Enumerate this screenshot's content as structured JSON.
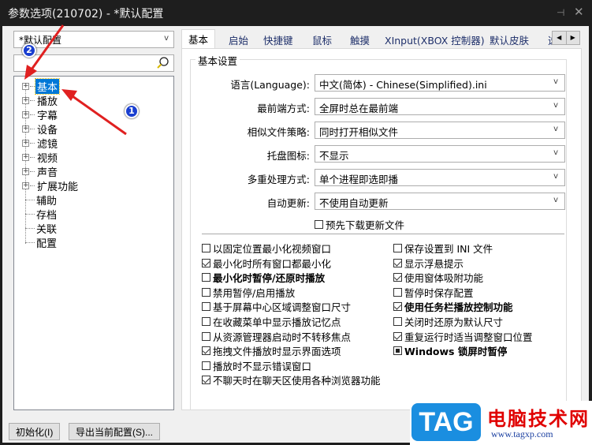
{
  "window": {
    "title": "参数选项(210702) - *默认配置",
    "pin_icon": "pin-icon",
    "close_icon": "close-icon"
  },
  "sidebar": {
    "profile_select": "*默认配置",
    "search_placeholder": "",
    "tree": [
      {
        "label": "基本",
        "expandable": true,
        "selected": true
      },
      {
        "label": "播放",
        "expandable": true
      },
      {
        "label": "字幕",
        "expandable": true
      },
      {
        "label": "设备",
        "expandable": true
      },
      {
        "label": "滤镜",
        "expandable": true
      },
      {
        "label": "视频",
        "expandable": true
      },
      {
        "label": "声音",
        "expandable": true
      },
      {
        "label": "扩展功能",
        "expandable": true
      },
      {
        "label": "辅助",
        "expandable": false
      },
      {
        "label": "存档",
        "expandable": false
      },
      {
        "label": "关联",
        "expandable": false
      },
      {
        "label": "配置",
        "expandable": false
      }
    ]
  },
  "tabs": [
    {
      "label": "基本",
      "active": true
    },
    {
      "label": "启始"
    },
    {
      "label": "快捷键"
    },
    {
      "label": "鼠标"
    },
    {
      "label": "触摸"
    },
    {
      "label": "XInput(XBOX 控制器)"
    },
    {
      "label": "默认皮肤"
    },
    {
      "label": "选"
    }
  ],
  "tab_scroll": {
    "left": "◀",
    "right": "▶"
  },
  "basic_settings": {
    "group_title": "基本设置",
    "fields": [
      {
        "label": "语言(Language):",
        "value": "中文(简体) - Chinese(Simplified).ini"
      },
      {
        "label": "最前端方式:",
        "value": "全屏时总在最前端"
      },
      {
        "label": "相似文件策略:",
        "value": "同时打开相似文件"
      },
      {
        "label": "托盘图标:",
        "value": "不显示"
      },
      {
        "label": "多重处理方式:",
        "value": "单个进程即选即播"
      },
      {
        "label": "自动更新:",
        "value": "不使用自动更新"
      }
    ],
    "predownload": {
      "label": "预先下载更新文件",
      "checked": false
    },
    "left_options": [
      {
        "label": "以固定位置最小化视频窗口",
        "state": "unchecked"
      },
      {
        "label": "最小化时所有窗口都最小化",
        "state": "checked"
      },
      {
        "label": "最小化时暂停/还原时播放",
        "state": "unchecked",
        "bold": true
      },
      {
        "label": "禁用暂停/启用播放",
        "state": "unchecked"
      },
      {
        "label": "基于屏幕中心区域调整窗口尺寸",
        "state": "unchecked"
      },
      {
        "label": "在收藏菜单中显示播放记忆点",
        "state": "unchecked"
      },
      {
        "label": "从资源管理器启动时不转移焦点",
        "state": "unchecked"
      },
      {
        "label": "拖拽文件播放时显示界面选项",
        "state": "checked"
      },
      {
        "label": "播放时不显示错误窗口",
        "state": "unchecked"
      },
      {
        "label": "不聊天时在聊天区使用各种浏览器功能",
        "state": "checked"
      }
    ],
    "right_options": [
      {
        "label": "保存设置到 INI 文件",
        "state": "unchecked"
      },
      {
        "label": "显示浮悬提示",
        "state": "checked"
      },
      {
        "label": "使用窗体吸附功能",
        "state": "checked"
      },
      {
        "label": "暂停时保存配置",
        "state": "unchecked"
      },
      {
        "label": "使用任务栏播放控制功能",
        "state": "checked",
        "bold": true
      },
      {
        "label": "关闭时还原为默认尺寸",
        "state": "unchecked"
      },
      {
        "label": "重复运行时适当调整窗口位置",
        "state": "checked"
      },
      {
        "label": "Windows 锁屏时暂停",
        "state": "indeterminate",
        "bold": true
      }
    ]
  },
  "footer": {
    "reset_button": "初始化(I)",
    "export_button": "导出当前配置(S)..."
  },
  "annotations": {
    "badge_1": "1",
    "badge_2": "2",
    "arrow_color": "#e02020"
  },
  "watermark": {
    "logo": "TAG",
    "site_name": "电脑技术网",
    "url": "www.tagxp.com"
  }
}
